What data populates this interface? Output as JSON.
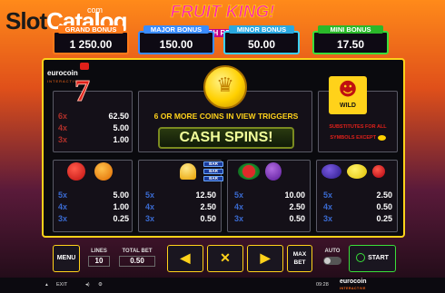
{
  "watermark": {
    "word1": "Slot",
    "word2": "Catalog",
    "sub": "com"
  },
  "logo": {
    "title": "FRUIT KING!",
    "subtitle": "CASH RESPIN"
  },
  "jackpots": [
    {
      "label": "GRAND BONUS",
      "value": "1 250.00"
    },
    {
      "label": "MAJOR BONUS",
      "value": "150.00"
    },
    {
      "label": "MINOR BONUS",
      "value": "50.00"
    },
    {
      "label": "MINI BONUS",
      "value": "17.50"
    }
  ],
  "brand": {
    "name": "eurocoin",
    "tag": "INTERACTIVE"
  },
  "paytable": {
    "seven": {
      "symbol": "7",
      "rows": [
        {
          "mult": "6x",
          "value": "62.50"
        },
        {
          "mult": "4x",
          "value": "5.00"
        },
        {
          "mult": "3x",
          "value": "1.00"
        }
      ]
    },
    "cherry_orange": {
      "rows": [
        {
          "mult": "5x",
          "value": "5.00"
        },
        {
          "mult": "4x",
          "value": "1.00"
        },
        {
          "mult": "3x",
          "value": "0.25"
        }
      ]
    },
    "bell_bar": {
      "bar_label": "BAR",
      "rows": [
        {
          "mult": "5x",
          "value": "12.50"
        },
        {
          "mult": "4x",
          "value": "2.50"
        },
        {
          "mult": "3x",
          "value": "0.50"
        }
      ]
    },
    "melon_grapes": {
      "rows": [
        {
          "mult": "5x",
          "value": "10.00"
        },
        {
          "mult": "4x",
          "value": "2.50"
        },
        {
          "mult": "3x",
          "value": "0.50"
        }
      ]
    },
    "plum_lemon_cherry": {
      "rows": [
        {
          "mult": "5x",
          "value": "2.50"
        },
        {
          "mult": "4x",
          "value": "0.50"
        },
        {
          "mult": "3x",
          "value": "0.25"
        }
      ]
    }
  },
  "feature": {
    "trigger": "6 OR MORE COINS IN VIEW TRIGGERS",
    "cash_spins": "CASH  SPINS!"
  },
  "wild": {
    "label": "WILD",
    "line1": "SUBSTITUTES FOR ALL",
    "line2": "SYMBOLS EXCEPT"
  },
  "controls": {
    "menu": "MENU",
    "lines_label": "LINES",
    "lines_value": "10",
    "total_bet_label": "TOTAL BET",
    "total_bet_value": "0.50",
    "prev_icon": "◀",
    "close_icon": "✕",
    "next_icon": "▶",
    "max_bet_line1": "MAX",
    "max_bet_line2": "BET",
    "auto_label": "AUTO",
    "start": "START"
  },
  "status_bar": {
    "exit": "EXIT",
    "time": "09:28"
  },
  "colors": {
    "gold": "#ffd21a",
    "grand": "#ff7a1a",
    "major": "#3a8cff",
    "minor": "#3ad0ff",
    "mini": "#3adf3a"
  }
}
